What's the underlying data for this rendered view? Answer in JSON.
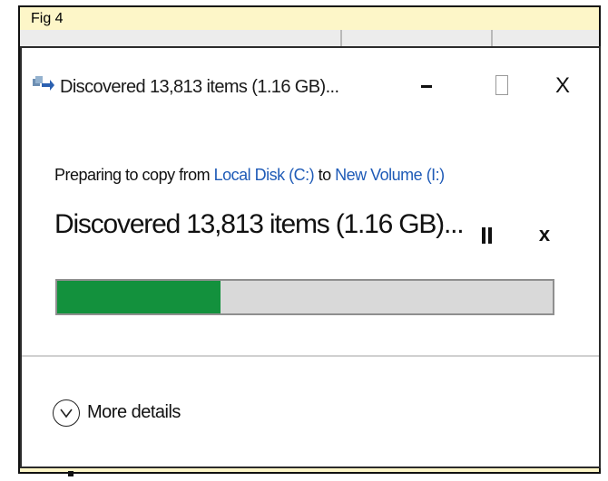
{
  "figure": {
    "label": "Fig 4"
  },
  "window": {
    "title": "Discovered 13,813 items (1.16 GB)...",
    "controls": {
      "minimize": "–",
      "maximize": "□",
      "close": "X"
    }
  },
  "copy": {
    "prefix": "Preparing to copy from ",
    "source": "Local Disk (C:)",
    "middle": " to ",
    "destination": "New Volume (I:)"
  },
  "status": {
    "text": "Discovered 13,813 items (1.16 GB)...",
    "pause_icon": "pause-icon",
    "stop_label": "x"
  },
  "progress": {
    "fraction": 0.33,
    "fill_color": "#13913d"
  },
  "footer": {
    "details_label": "More details",
    "details_icon": "chevron-down-icon"
  },
  "colors": {
    "frame_bg": "#fdf6c8",
    "link": "#1f5bb7"
  }
}
